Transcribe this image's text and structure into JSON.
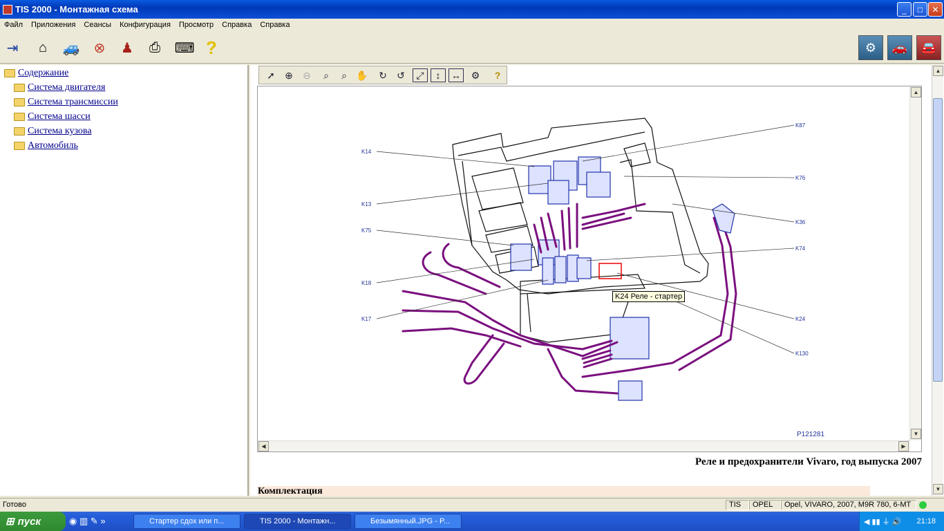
{
  "window": {
    "title": "TIS 2000 - Монтажная схема"
  },
  "menu": [
    "Файл",
    "Приложения",
    "Сеансы",
    "Конфигурация",
    "Просмотр",
    "Справка",
    "Справка"
  ],
  "tree": {
    "root": "Содержание",
    "items": [
      "Система двигателя",
      "Система трансмиссии",
      "Система шасси",
      "Система кузова",
      "Автомобиль"
    ]
  },
  "diagram": {
    "labels_left": [
      "K14",
      "K13",
      "K75",
      "K18",
      "K17"
    ],
    "labels_right": [
      "K87",
      "K76",
      "K36",
      "K74",
      "K24",
      "K130"
    ],
    "tooltip": "K24 Реле - стартер",
    "ref": "P121281"
  },
  "caption": "Реле и предохранители Vivaro, год выпуска 2007",
  "below_caption": "Комплектация",
  "status": {
    "left": "Готово",
    "cells": [
      "TIS",
      "OPEL",
      "Opel, VIVARO, 2007, M9R 780, 6-MT"
    ]
  },
  "taskbar": {
    "start": "пуск",
    "tasks": [
      "Стартер сдох или п...",
      "TIS 2000 - Монтажн...",
      "Безымянный.JPG - P..."
    ],
    "clock": "21:18"
  },
  "colors": {
    "harness": "#7a0f7e",
    "relay": "#2233aa",
    "titlebar": "#0a5ae0"
  }
}
